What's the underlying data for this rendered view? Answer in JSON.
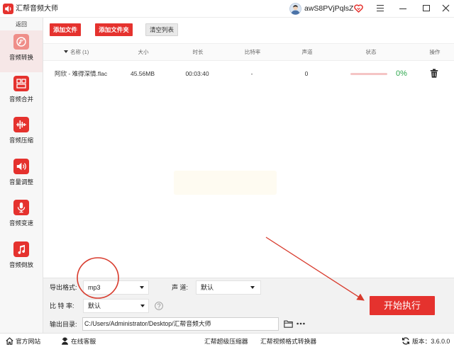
{
  "window": {
    "title": "汇帮音频大师",
    "username": "awS8PVjPqlsZ",
    "icons": {
      "logo": "app-logo-icon",
      "avatar": "user-avatar",
      "vip": "vip-heart-icon",
      "menu": "menu-icon",
      "minimize": "minimize-icon",
      "maximize": "maximize-icon",
      "close": "close-icon"
    }
  },
  "sidebar": {
    "back_label": "返回",
    "items": [
      {
        "label": "音频转换",
        "icon": "audio-convert-icon",
        "active": true
      },
      {
        "label": "音频合并",
        "icon": "audio-merge-icon",
        "active": false
      },
      {
        "label": "音频压缩",
        "icon": "audio-compress-icon",
        "active": false
      },
      {
        "label": "音量调整",
        "icon": "volume-icon",
        "active": false
      },
      {
        "label": "音频变速",
        "icon": "microphone-icon",
        "active": false
      },
      {
        "label": "音频倒放",
        "icon": "music-note-icon",
        "active": false
      }
    ]
  },
  "toolbar": {
    "add_file": "添加文件",
    "add_folder": "添加文件夹",
    "clear_list": "清空列表"
  },
  "table": {
    "sort_icon": "sort-desc-icon",
    "columns": {
      "name": "名称 (1)",
      "size": "大小",
      "duration": "时长",
      "bitrate": "比特率",
      "channels": "声道",
      "status": "状态",
      "actions": "操作"
    },
    "rows": [
      {
        "name": "阿欣 - 难得深情.flac",
        "size": "45.56MB",
        "duration": "00:03:40",
        "bitrate": "-",
        "channels": "0",
        "progress": 0,
        "progress_label": "0%",
        "action_icon": "trash-icon"
      }
    ]
  },
  "settings": {
    "format": {
      "label": "导出格式:",
      "value": "mp3"
    },
    "channel": {
      "label": "声 道:",
      "value": "默认"
    },
    "bitrate": {
      "label": "比 特 率:",
      "value": "默认",
      "help_icon": "help-icon"
    },
    "output": {
      "label": "输出目录:",
      "path": "C:/Users/Administrator/Desktop/汇帮音频大师",
      "folder_icon": "folder-icon",
      "more_icon": "more-icon"
    }
  },
  "start_button": {
    "label": "开始执行"
  },
  "footer": {
    "website": {
      "label": "官方网站",
      "icon": "home-icon"
    },
    "support": {
      "label": "在线客服",
      "icon": "support-icon"
    },
    "links": [
      "汇帮超级压缩器",
      "汇帮视频格式转换器"
    ],
    "version": {
      "label": "版本：3.6.0.0",
      "icon": "refresh-icon"
    }
  },
  "colors": {
    "brand_red": "#e5322e",
    "progress_green": "#2ea84e",
    "progress_track": "#f5c5c5",
    "active_sidebar_bg": "#f6e7e7",
    "settings_bg": "#f2f2f2",
    "annotation_red": "#d83b2d"
  }
}
